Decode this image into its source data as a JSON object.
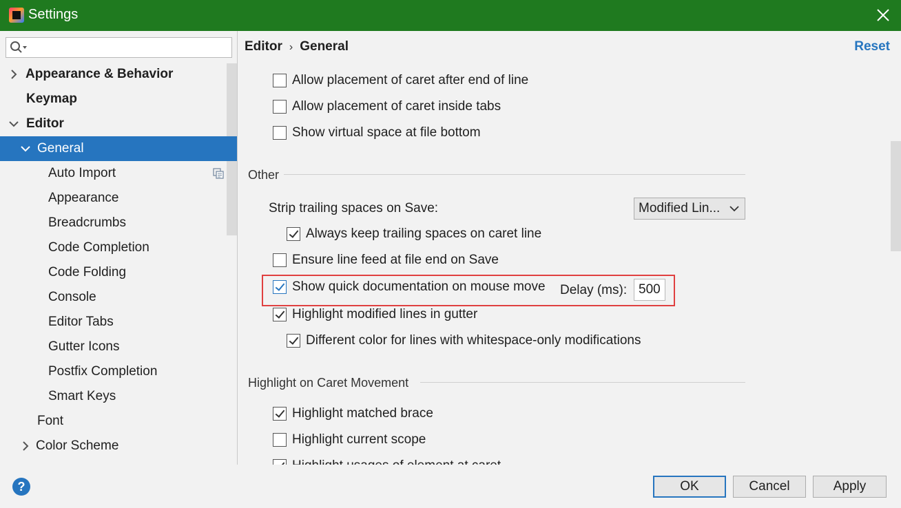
{
  "window": {
    "title": "Settings",
    "icons": {
      "app": "intellij-app-icon",
      "close": "close-icon"
    }
  },
  "search": {
    "value": "",
    "placeholder": "",
    "icon": "search-icon"
  },
  "tree": {
    "items": [
      {
        "label": "Appearance & Behavior",
        "bold": true,
        "expander": "collapsed"
      },
      {
        "label": "Keymap",
        "bold": true
      },
      {
        "label": "Editor",
        "bold": true,
        "expander": "expanded"
      },
      {
        "label": "General",
        "selected": true,
        "expander": "expanded"
      },
      {
        "label": "Auto Import",
        "badge_icon": "copy-icon"
      },
      {
        "label": "Appearance"
      },
      {
        "label": "Breadcrumbs"
      },
      {
        "label": "Code Completion"
      },
      {
        "label": "Code Folding"
      },
      {
        "label": "Console"
      },
      {
        "label": "Editor Tabs"
      },
      {
        "label": "Gutter Icons"
      },
      {
        "label": "Postfix Completion"
      },
      {
        "label": "Smart Keys"
      },
      {
        "label": "Font"
      },
      {
        "label": "Color Scheme",
        "expander": "collapsed"
      }
    ]
  },
  "breadcrumb": {
    "parent": "Editor",
    "separator": "›",
    "current": "General"
  },
  "reset_label": "Reset",
  "caret_options": [
    {
      "label": "Allow placement of caret after end of line",
      "checked": false
    },
    {
      "label": "Allow placement of caret inside tabs",
      "checked": false
    },
    {
      "label": "Show virtual space at file bottom",
      "checked": false
    }
  ],
  "other": {
    "title": "Other",
    "strip_label": "Strip trailing spaces on Save:",
    "strip_value": "Modified Lin...",
    "keep_trailing": {
      "label": "Always keep trailing spaces on caret line",
      "checked": true
    },
    "ensure_lf": {
      "label": "Ensure line feed at file end on Save",
      "checked": false
    },
    "quick_doc": {
      "label": "Show quick documentation on mouse move",
      "checked": true,
      "delay_label": "Delay (ms):",
      "delay_value": "500"
    },
    "highlight_modified": {
      "label": "Highlight modified lines in gutter",
      "checked": true
    },
    "different_color": {
      "label": "Different color for lines with whitespace-only modifications",
      "checked": true
    }
  },
  "caret_movement": {
    "title": "Highlight on Caret Movement",
    "matched_brace": {
      "label": "Highlight matched brace",
      "checked": true
    },
    "current_scope": {
      "label": "Highlight current scope",
      "checked": false
    },
    "usages": {
      "label": "Highlight usages of element at caret",
      "checked": true
    }
  },
  "footer": {
    "help": "?",
    "ok": "OK",
    "cancel": "Cancel",
    "apply": "Apply"
  },
  "colors": {
    "titlebar": "#1f7a1f",
    "selection": "#2675bf",
    "highlight_box": "#e04040"
  }
}
